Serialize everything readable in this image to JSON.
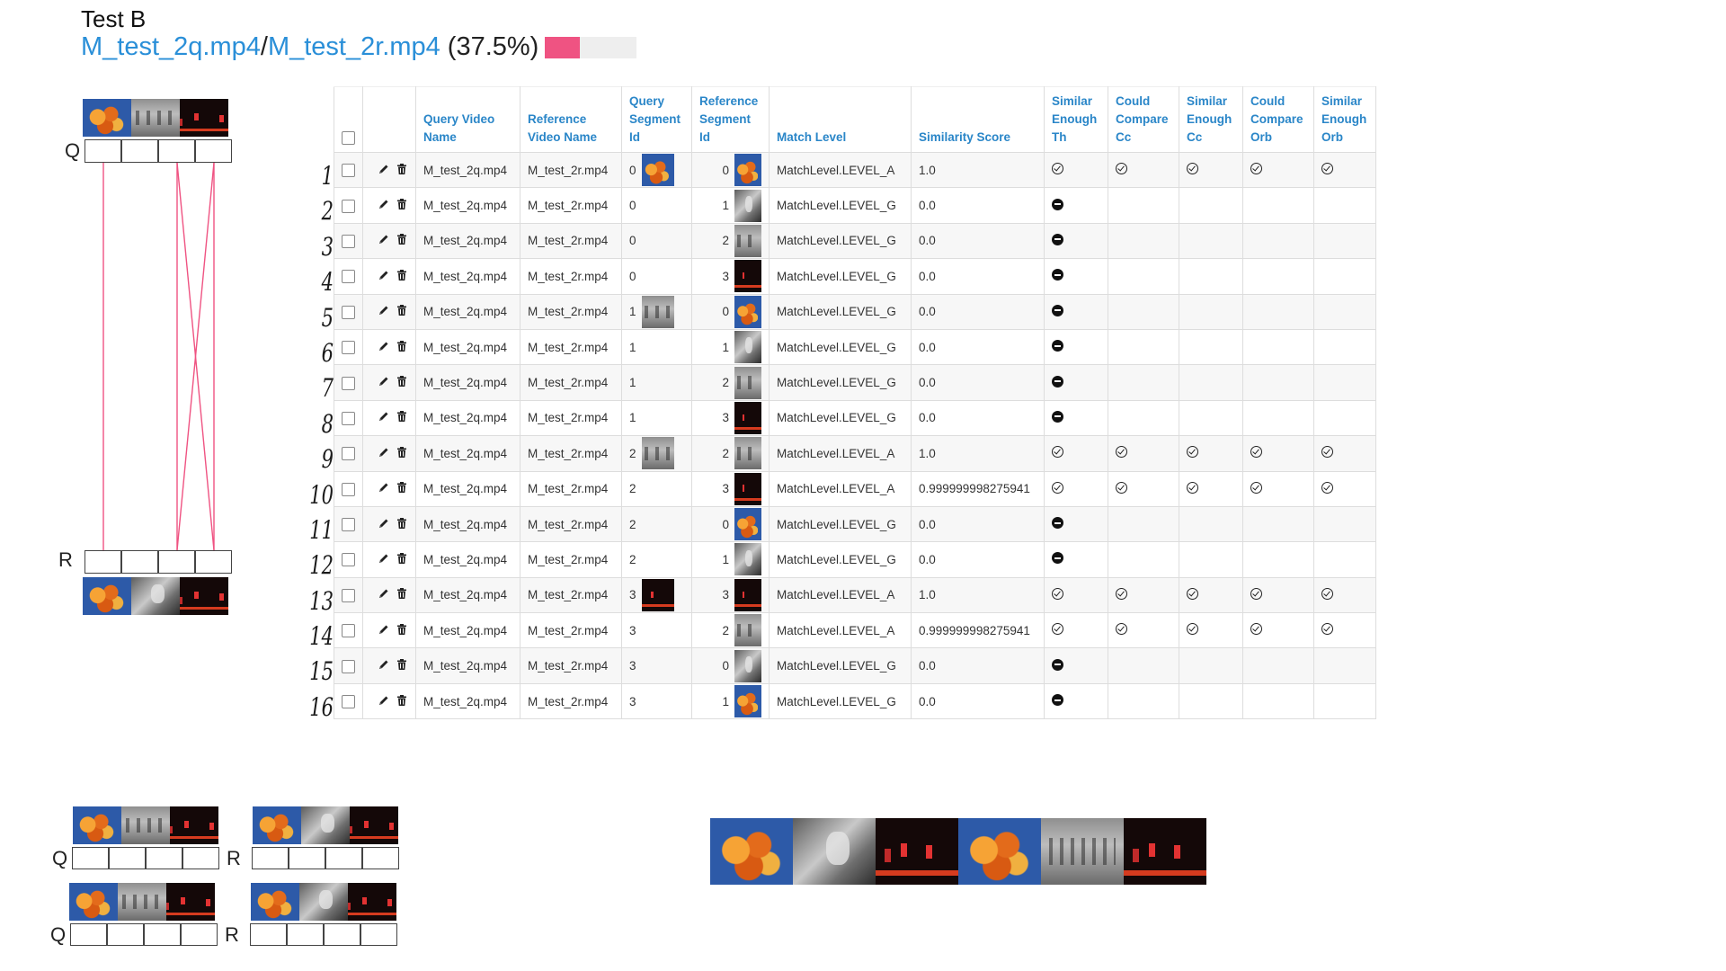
{
  "header": {
    "title": "Test B",
    "query_file": "M_test_2q.mp4",
    "separator": " / ",
    "reference_file": "M_test_2r.mp4",
    "percent_text": "(37.5%)",
    "progress_fraction": 0.375,
    "progress_color": "#ef5382"
  },
  "viz": {
    "q_label": "Q",
    "r_label": "R"
  },
  "mini_labels": {
    "q": "Q",
    "r": "R"
  },
  "table": {
    "headers": {
      "query_video_name": "Query Video Name",
      "reference_video_name": "Reference Video Name",
      "query_segment_id": "Query Segment Id",
      "reference_segment_id": "Reference Segment Id",
      "match_level": "Match Level",
      "similarity_score": "Similarity Score",
      "similar_enough_th": "Similar Enough Th",
      "could_compare_cc": "Could Compare Cc",
      "similar_enough_cc": "Similar Enough Cc",
      "could_compare_orb": "Could Compare Orb",
      "similar_enough_orb": "Similar Enough Orb"
    },
    "rows": [
      {
        "n": "1",
        "q": "M_test_2q.mp4",
        "r": "M_test_2r.mp4",
        "qs": "0",
        "rs": "0",
        "ml": "MatchLevel.LEVEL_A",
        "score": "1.0",
        "qthumb": "maple",
        "rthumb": "maple",
        "flags": "all"
      },
      {
        "n": "2",
        "q": "M_test_2q.mp4",
        "r": "M_test_2r.mp4",
        "qs": "0",
        "rs": "1",
        "ml": "MatchLevel.LEVEL_G",
        "score": "0.0",
        "qthumb": "",
        "rthumb": "gray",
        "flags": "none"
      },
      {
        "n": "3",
        "q": "M_test_2q.mp4",
        "r": "M_test_2r.mp4",
        "qs": "0",
        "rs": "2",
        "ml": "MatchLevel.LEVEL_G",
        "score": "0.0",
        "qthumb": "",
        "rthumb": "street",
        "flags": "none"
      },
      {
        "n": "4",
        "q": "M_test_2q.mp4",
        "r": "M_test_2r.mp4",
        "qs": "0",
        "rs": "3",
        "ml": "MatchLevel.LEVEL_G",
        "score": "0.0",
        "qthumb": "",
        "rthumb": "red",
        "flags": "none"
      },
      {
        "n": "5",
        "q": "M_test_2q.mp4",
        "r": "M_test_2r.mp4",
        "qs": "1",
        "rs": "0",
        "ml": "MatchLevel.LEVEL_G",
        "score": "0.0",
        "qthumb": "street",
        "rthumb": "maple",
        "flags": "none"
      },
      {
        "n": "6",
        "q": "M_test_2q.mp4",
        "r": "M_test_2r.mp4",
        "qs": "1",
        "rs": "1",
        "ml": "MatchLevel.LEVEL_G",
        "score": "0.0",
        "qthumb": "",
        "rthumb": "gray",
        "flags": "none"
      },
      {
        "n": "7",
        "q": "M_test_2q.mp4",
        "r": "M_test_2r.mp4",
        "qs": "1",
        "rs": "2",
        "ml": "MatchLevel.LEVEL_G",
        "score": "0.0",
        "qthumb": "",
        "rthumb": "street",
        "flags": "none"
      },
      {
        "n": "8",
        "q": "M_test_2q.mp4",
        "r": "M_test_2r.mp4",
        "qs": "1",
        "rs": "3",
        "ml": "MatchLevel.LEVEL_G",
        "score": "0.0",
        "qthumb": "",
        "rthumb": "red",
        "flags": "none"
      },
      {
        "n": "9",
        "q": "M_test_2q.mp4",
        "r": "M_test_2r.mp4",
        "qs": "2",
        "rs": "2",
        "ml": "MatchLevel.LEVEL_A",
        "score": "1.0",
        "qthumb": "street",
        "rthumb": "street",
        "flags": "all"
      },
      {
        "n": "10",
        "q": "M_test_2q.mp4",
        "r": "M_test_2r.mp4",
        "qs": "2",
        "rs": "3",
        "ml": "MatchLevel.LEVEL_A",
        "score": "0.999999998275941",
        "qthumb": "",
        "rthumb": "red",
        "flags": "all"
      },
      {
        "n": "11",
        "q": "M_test_2q.mp4",
        "r": "M_test_2r.mp4",
        "qs": "2",
        "rs": "0",
        "ml": "MatchLevel.LEVEL_G",
        "score": "0.0",
        "qthumb": "",
        "rthumb": "maple",
        "flags": "none"
      },
      {
        "n": "12",
        "q": "M_test_2q.mp4",
        "r": "M_test_2r.mp4",
        "qs": "2",
        "rs": "1",
        "ml": "MatchLevel.LEVEL_G",
        "score": "0.0",
        "qthumb": "",
        "rthumb": "gray",
        "flags": "none"
      },
      {
        "n": "13",
        "q": "M_test_2q.mp4",
        "r": "M_test_2r.mp4",
        "qs": "3",
        "rs": "3",
        "ml": "MatchLevel.LEVEL_A",
        "score": "1.0",
        "qthumb": "red",
        "rthumb": "red",
        "flags": "all"
      },
      {
        "n": "14",
        "q": "M_test_2q.mp4",
        "r": "M_test_2r.mp4",
        "qs": "3",
        "rs": "2",
        "ml": "MatchLevel.LEVEL_A",
        "score": "0.999999998275941",
        "qthumb": "",
        "rthumb": "street",
        "flags": "all"
      },
      {
        "n": "15",
        "q": "M_test_2q.mp4",
        "r": "M_test_2r.mp4",
        "qs": "3",
        "rs": "0",
        "ml": "MatchLevel.LEVEL_G",
        "score": "0.0",
        "qthumb": "",
        "rthumb": "gray",
        "flags": "none"
      },
      {
        "n": "16",
        "q": "M_test_2q.mp4",
        "r": "M_test_2r.mp4",
        "qs": "3",
        "rs": "1",
        "ml": "MatchLevel.LEVEL_G",
        "score": "0.0",
        "qthumb": "",
        "rthumb": "maple",
        "flags": "none"
      }
    ]
  },
  "icons": {
    "edit": "pencil-icon",
    "delete": "trash-icon",
    "match": "check-circle-icon",
    "no_match": "minus-circle-icon"
  },
  "filmstrip": [
    "maple",
    "gray",
    "red",
    "maple",
    "street",
    "red"
  ],
  "colors": {
    "link": "#2a8fd8",
    "header_text": "#2a86c8",
    "match_line": "#ef5382"
  }
}
